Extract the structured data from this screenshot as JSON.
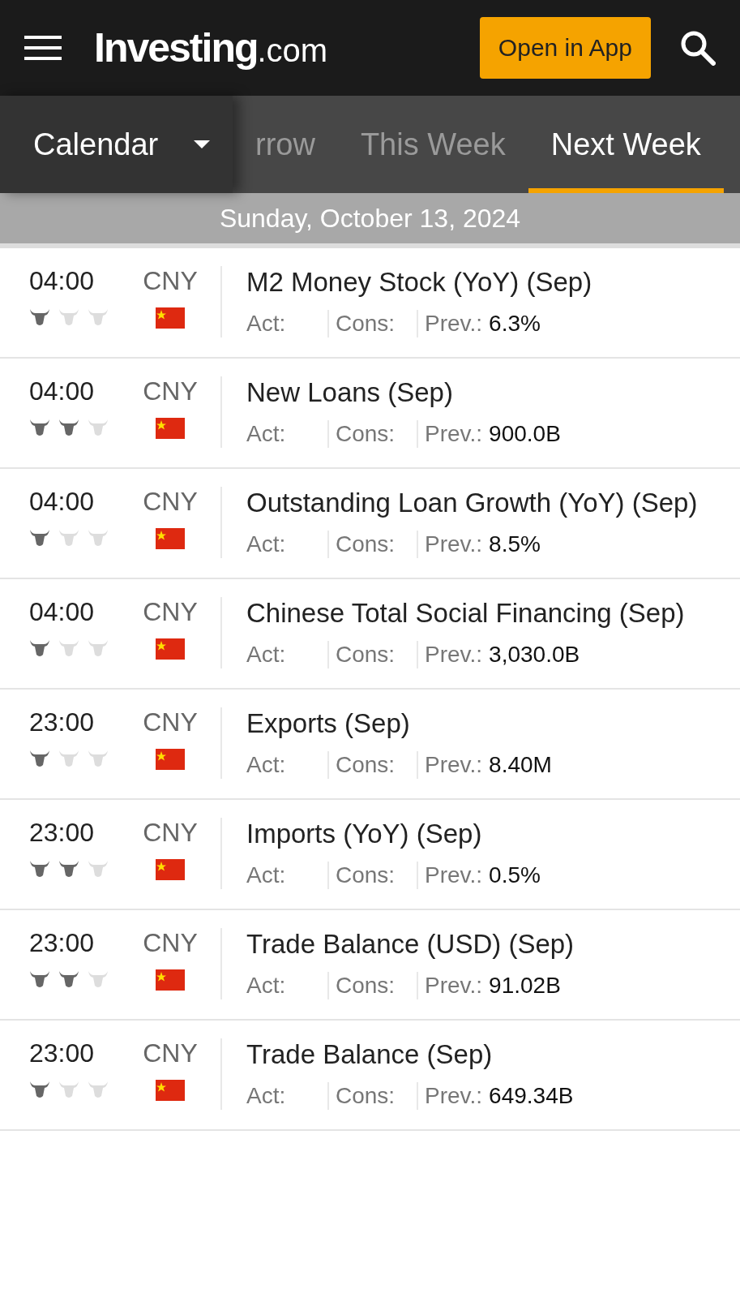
{
  "header": {
    "logo": {
      "name": "Investing",
      "suffix": ".com"
    },
    "open_button": "Open in App"
  },
  "tabs_bar": {
    "dropdown": "Calendar",
    "tabs": [
      {
        "label": "rrow",
        "selected": false
      },
      {
        "label": "This Week",
        "selected": false
      },
      {
        "label": "Next Week",
        "selected": true
      }
    ]
  },
  "date": "Sunday, October 13, 2024",
  "events": [
    {
      "time": "04:00",
      "currency": "CNY",
      "stars": 1,
      "title": "M2 Money Stock (YoY) (Sep)",
      "act_label": "Act:",
      "cons_label": "Cons:",
      "prev_label": "Prev.:",
      "prev": "6.3%"
    },
    {
      "time": "04:00",
      "currency": "CNY",
      "stars": 2,
      "title": "New Loans (Sep)",
      "act_label": "Act:",
      "cons_label": "Cons:",
      "prev_label": "Prev.:",
      "prev": "900.0B"
    },
    {
      "time": "04:00",
      "currency": "CNY",
      "stars": 1,
      "title": "Outstanding Loan Growth (YoY) (Sep)",
      "act_label": "Act:",
      "cons_label": "Cons:",
      "prev_label": "Prev.:",
      "prev": "8.5%"
    },
    {
      "time": "04:00",
      "currency": "CNY",
      "stars": 1,
      "title": "Chinese Total Social Financing (Sep)",
      "act_label": "Act:",
      "cons_label": "Cons:",
      "prev_label": "Prev.:",
      "prev": "3,030.0B"
    },
    {
      "time": "23:00",
      "currency": "CNY",
      "stars": 1,
      "title": "Exports (Sep)",
      "act_label": "Act:",
      "cons_label": "Cons:",
      "prev_label": "Prev.:",
      "prev": "8.40M"
    },
    {
      "time": "23:00",
      "currency": "CNY",
      "stars": 2,
      "title": "Imports (YoY) (Sep)",
      "act_label": "Act:",
      "cons_label": "Cons:",
      "prev_label": "Prev.:",
      "prev": "0.5%"
    },
    {
      "time": "23:00",
      "currency": "CNY",
      "stars": 2,
      "title": "Trade Balance (USD) (Sep)",
      "act_label": "Act:",
      "cons_label": "Cons:",
      "prev_label": "Prev.:",
      "prev": "91.02B"
    },
    {
      "time": "23:00",
      "currency": "CNY",
      "stars": 1,
      "title": "Trade Balance (Sep)",
      "act_label": "Act:",
      "cons_label": "Cons:",
      "prev_label": "Prev.:",
      "prev": "649.34B"
    }
  ]
}
